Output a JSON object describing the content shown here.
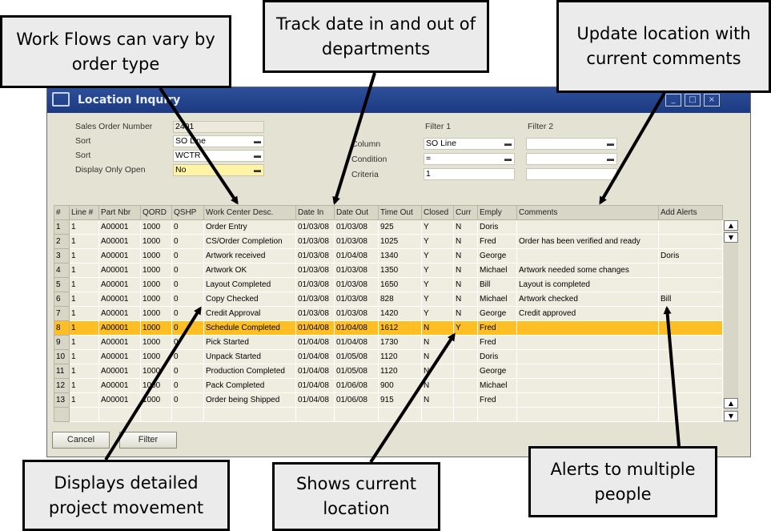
{
  "window": {
    "title": "Location Inquiry"
  },
  "form": {
    "sales_order_number_label": "Sales Order Number",
    "sales_order_number_value": "2401",
    "sort1_label": "Sort",
    "sort1_value": "SO Line",
    "sort2_label": "Sort",
    "sort2_value": "WCTR",
    "display_open_label": "Display Only Open",
    "display_open_value": "No",
    "filter1_label": "Filter 1",
    "filter2_label": "Filter 2",
    "column_label": "Column",
    "column_value": "SO Line",
    "condition_label": "Condition",
    "condition_value": "=",
    "criteria_label": "Criteria",
    "criteria_value": "1",
    "filter2_column_value": "",
    "filter2_condition_value": "",
    "filter2_criteria_value": ""
  },
  "grid": {
    "columns": [
      "#",
      "Line #",
      "Part Nbr",
      "QORD",
      "QSHP",
      "Work Center Desc.",
      "Date In",
      "Date Out",
      "Time Out",
      "Closed",
      "Curr",
      "Emply",
      "Comments",
      "Add Alerts"
    ],
    "rows": [
      [
        "1",
        "1",
        "A00001",
        "1000",
        "0",
        "Order Entry",
        "01/03/08",
        "01/03/08",
        "925",
        "Y",
        "N",
        "Doris",
        "",
        ""
      ],
      [
        "2",
        "1",
        "A00001",
        "1000",
        "0",
        "CS/Order Completion",
        "01/03/08",
        "01/03/08",
        "1025",
        "Y",
        "N",
        "Fred",
        "Order has been verified and ready",
        ""
      ],
      [
        "3",
        "1",
        "A00001",
        "1000",
        "0",
        "Artwork received",
        "01/03/08",
        "01/04/08",
        "1340",
        "Y",
        "N",
        "George",
        "",
        "Doris"
      ],
      [
        "4",
        "1",
        "A00001",
        "1000",
        "0",
        "Artwork OK",
        "01/03/08",
        "01/03/08",
        "1350",
        "Y",
        "N",
        "Michael",
        "Artwork needed some changes",
        ""
      ],
      [
        "5",
        "1",
        "A00001",
        "1000",
        "0",
        "Layout Completed",
        "01/03/08",
        "01/03/08",
        "1650",
        "Y",
        "N",
        "Bill",
        "Layout is completed",
        ""
      ],
      [
        "6",
        "1",
        "A00001",
        "1000",
        "0",
        "Copy Checked",
        "01/03/08",
        "01/03/08",
        "828",
        "Y",
        "N",
        "Michael",
        "Artwork checked",
        "Bill"
      ],
      [
        "7",
        "1",
        "A00001",
        "1000",
        "0",
        "Credit Approval",
        "01/03/08",
        "01/03/08",
        "1420",
        "Y",
        "N",
        "George",
        "Credit approved",
        ""
      ],
      [
        "8",
        "1",
        "A00001",
        "1000",
        "0",
        "Schedule Completed",
        "01/04/08",
        "01/04/08",
        "1612",
        "N",
        "Y",
        "Fred",
        "",
        ""
      ],
      [
        "9",
        "1",
        "A00001",
        "1000",
        "0",
        "Pick Started",
        "01/04/08",
        "01/04/08",
        "1730",
        "N",
        "",
        "Fred",
        "",
        ""
      ],
      [
        "10",
        "1",
        "A00001",
        "1000",
        "0",
        "Unpack Started",
        "01/04/08",
        "01/05/08",
        "1120",
        "N",
        "",
        "Doris",
        "",
        ""
      ],
      [
        "11",
        "1",
        "A00001",
        "1000",
        "0",
        "Production Completed",
        "01/04/08",
        "01/05/08",
        "1120",
        "N",
        "",
        "George",
        "",
        ""
      ],
      [
        "12",
        "1",
        "A00001",
        "1000",
        "0",
        "Pack Completed",
        "01/04/08",
        "01/06/08",
        "900",
        "N",
        "",
        "Michael",
        "",
        ""
      ],
      [
        "13",
        "1",
        "A00001",
        "1000",
        "0",
        "Order being Shipped",
        "01/04/08",
        "01/06/08",
        "915",
        "N",
        "",
        "Fred",
        "",
        ""
      ]
    ],
    "selected_row_index": 7
  },
  "buttons": {
    "cancel": "Cancel",
    "filter": "Filter"
  },
  "callouts": {
    "work_flows": "Work Flows can vary by order type",
    "track_date": "Track date in and out of departments",
    "update_location": "Update location with current comments",
    "detailed_movement": "Displays detailed project movement",
    "current_location": "Shows current location",
    "alerts": "Alerts to multiple people"
  },
  "colors": {
    "selected_row": "#ffbf24",
    "titlebar": "#1c3a82",
    "window_bg": "#e4e2d3",
    "callout_bg": "#ebebeb"
  }
}
